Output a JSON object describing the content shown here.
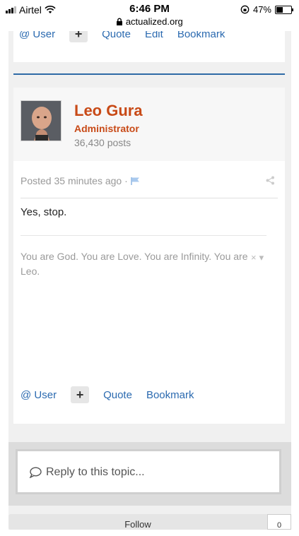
{
  "status_bar": {
    "carrier": "Airtel",
    "time": "6:46 PM",
    "url": "actualized.org",
    "battery": "47%"
  },
  "prev_post_actions": {
    "user": "@ User",
    "plus": "+",
    "quote": "Quote",
    "edit": "Edit",
    "bookmark": "Bookmark"
  },
  "post": {
    "author_name": "Leo Gura",
    "author_role": "Administrator",
    "author_posts": "36,430 posts",
    "posted": "Posted 35 minutes ago ·",
    "body": "Yes, stop.",
    "signature": "You are God. You are Love. You are Infinity. You are Leo.",
    "signature_close": "×",
    "signature_menu": "▾",
    "actions": {
      "user": "@ User",
      "plus": "+",
      "quote": "Quote",
      "bookmark": "Bookmark"
    }
  },
  "reply": {
    "placeholder": "Reply to this topic..."
  },
  "follow": {
    "label": "Follow",
    "count": "0"
  },
  "colors": {
    "accent_blue": "#2b6ab0",
    "author_orange": "#c84a17"
  }
}
